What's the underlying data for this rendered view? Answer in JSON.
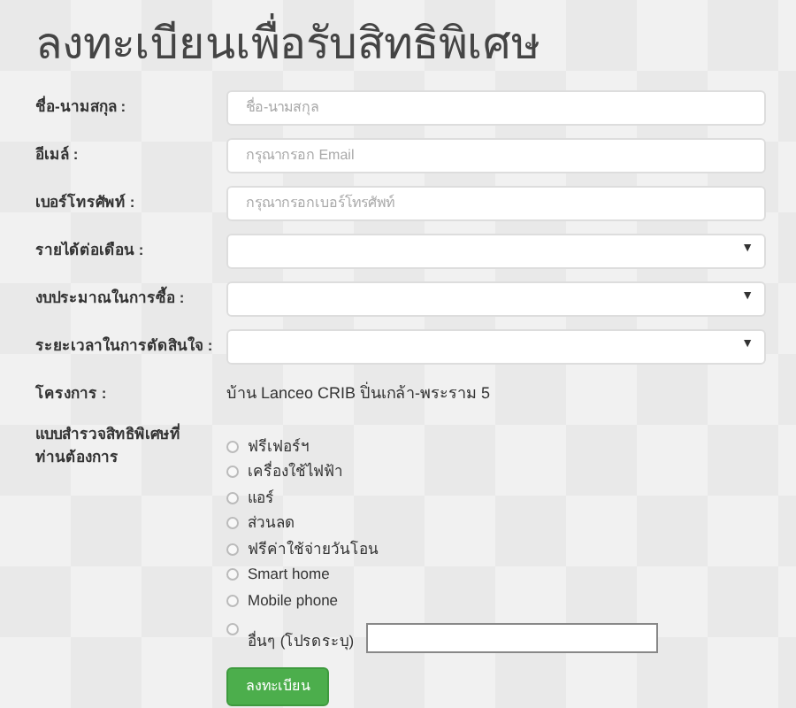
{
  "title": "ลงทะเบียนเพื่อรับสิทธิพิเศษ",
  "fields": [
    {
      "kind": "text",
      "label": "ชื่อ-นามสกุล :",
      "placeholder": "ชื่อ-นามสกุล"
    },
    {
      "kind": "text",
      "label": "อีเมล์ :",
      "placeholder": "กรุณากรอก Email"
    },
    {
      "kind": "text",
      "label": "เบอร์โทรศัพท์ :",
      "placeholder": "กรุณากรอกเบอร์โทรศัพท์"
    },
    {
      "kind": "select",
      "label": "รายได้ต่อเดือน :",
      "arrow": "▼"
    },
    {
      "kind": "select",
      "label": "งบประมาณในการซื้อ :",
      "arrow": "▼"
    },
    {
      "kind": "select",
      "label": "ระยะเวลาในการตัดสินใจ :",
      "arrow": "▼"
    },
    {
      "kind": "static",
      "label": "โครงการ :",
      "value": "บ้าน Lanceo CRIB ปิ่นเกล้า-พระราม 5"
    }
  ],
  "survey": {
    "label": "แบบสำรวจสิทธิพิเศษที่ท่านต้องการ",
    "options": [
      {
        "kind": "radio",
        "label": "ฟรีเฟอร์ฯ",
        "selected": false
      },
      {
        "kind": "radio",
        "label": "เครื่องใช้ไฟฟ้า",
        "selected": false
      },
      {
        "kind": "radio",
        "label": "แอร์",
        "selected": false
      },
      {
        "kind": "radio",
        "label": "ส่วนลด",
        "selected": false
      },
      {
        "kind": "radio",
        "label": "ฟรีค่าใช้จ่ายวันโอน",
        "selected": false
      },
      {
        "kind": "radio",
        "label": "Smart home",
        "selected": false
      },
      {
        "kind": "radio",
        "label": "Mobile phone",
        "selected": false
      },
      {
        "kind": "other",
        "label": "อื่นๆ (โปรดระบุ)",
        "selected": false
      }
    ]
  },
  "submit": "ลงทะเบียน"
}
